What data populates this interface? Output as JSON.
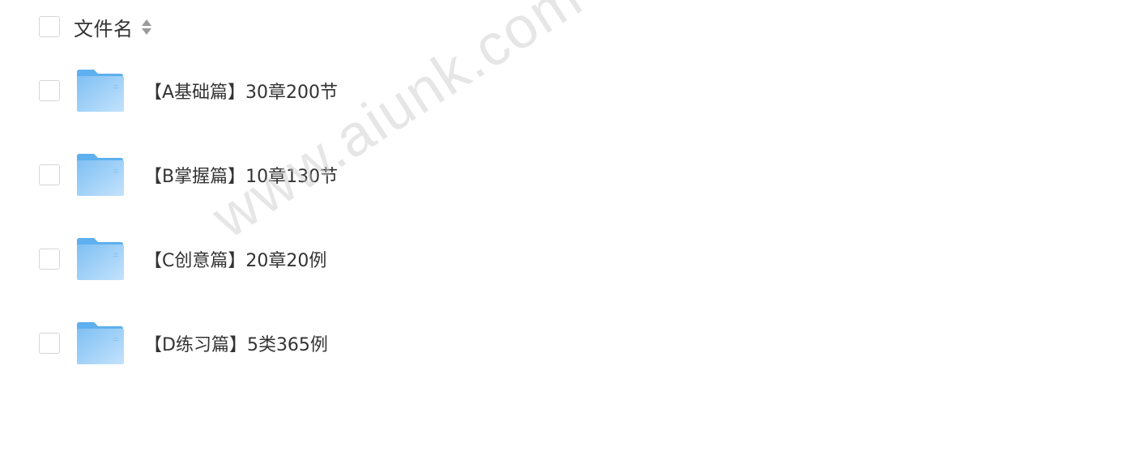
{
  "header": {
    "column_label": "文件名",
    "sort_icon": "sort-up-down-icon"
  },
  "files": [
    {
      "name": "【A基础篇】30章200节",
      "icon": "folder-icon"
    },
    {
      "name": "【B掌握篇】10章130节",
      "icon": "folder-icon"
    },
    {
      "name": "【C创意篇】20章20例",
      "icon": "folder-icon"
    },
    {
      "name": "【D练习篇】5类365例",
      "icon": "folder-icon"
    }
  ],
  "watermark": "www.aiunk.com",
  "colors": {
    "folder_light": "#b7dcfb",
    "folder_dark": "#5eb0ee",
    "checkbox_border": "#d6d6d6",
    "text": "#333333"
  }
}
